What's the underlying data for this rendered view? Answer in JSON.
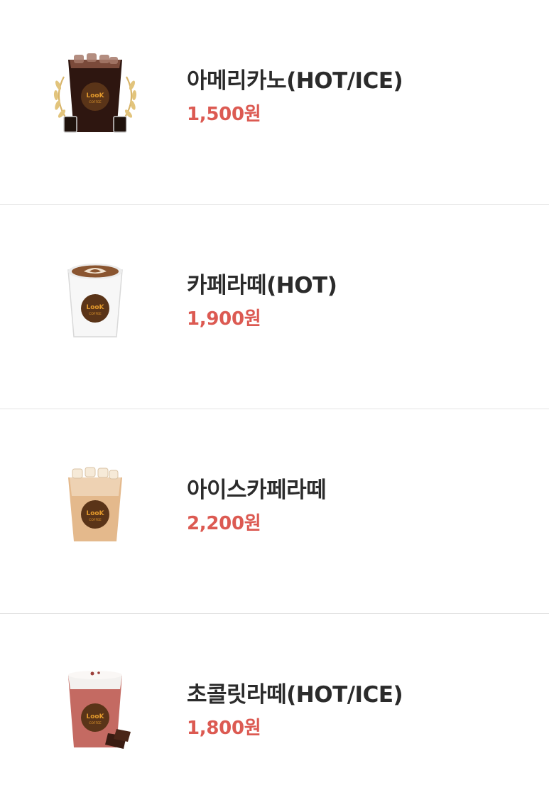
{
  "menu": {
    "items": [
      {
        "name": "아메리카노(HOT/ICE)",
        "price": "1,500원",
        "image_icon": "iced-americano-icon"
      },
      {
        "name": "카페라떼(HOT)",
        "price": "1,900원",
        "image_icon": "hot-latte-cup-icon"
      },
      {
        "name": "아이스카페라떼",
        "price": "2,200원",
        "image_icon": "iced-latte-icon"
      },
      {
        "name": "초콜릿라떼(HOT/ICE)",
        "price": "1,800원",
        "image_icon": "chocolate-latte-icon"
      }
    ],
    "logo_text": [
      "LooK",
      "COFFEE"
    ],
    "colors": {
      "name": "#2b2b2b",
      "price": "#dc5a52",
      "divider": "#e3e3e3",
      "logo_badge": "#5a3418",
      "logo_text": "#e49a2c"
    }
  }
}
